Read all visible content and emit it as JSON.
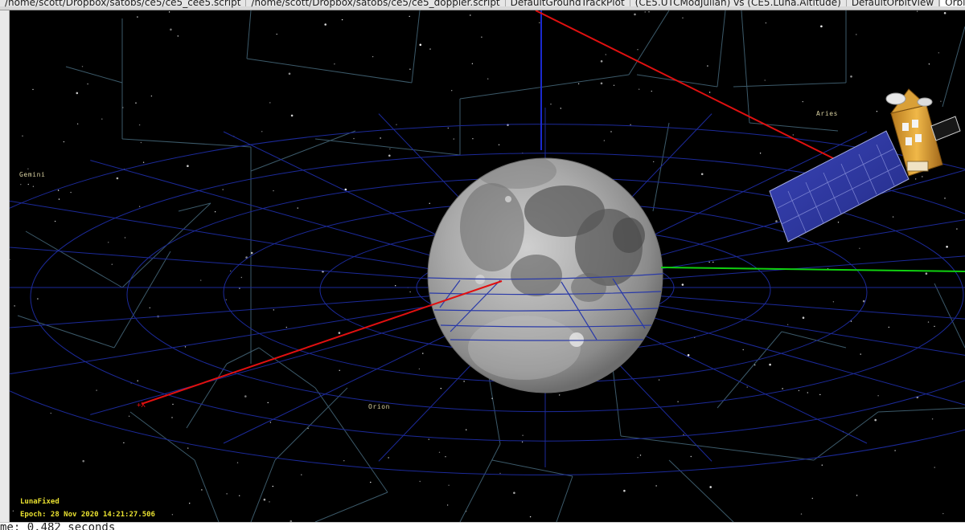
{
  "tabs": [
    {
      "label": "/home/scott/Dropbox/satobs/ce5/ce5_cee5.script",
      "active": false
    },
    {
      "label": "/home/scott/Dropbox/satobs/ce5/ce5_doppler.script",
      "active": false
    },
    {
      "label": "DefaultGroundTrackPlot",
      "active": false
    },
    {
      "label": "(CE5.UTCModJulian) vs (CE5.Luna.Altitude)",
      "active": false
    },
    {
      "label": "DefaultOrbitView",
      "active": false
    },
    {
      "label": "Orbit",
      "active": true
    }
  ],
  "view": {
    "constellations": {
      "gemini": "Gemini",
      "aries": "Aries",
      "orion": "Orion"
    },
    "coordinate_system": "LunaFixed",
    "epoch": "Epoch: 28 Nov 2020 14:21:27.506"
  },
  "console": {
    "text": "me: 0.482 seconds"
  },
  "colors": {
    "background": "#000000",
    "grid": "#1c2a9a",
    "constellation_lines": "#3c5a6a",
    "x_axis": "#e01010",
    "y_axis": "#10d010",
    "z_axis": "#1a2ad0",
    "hud_text": "#e8e030"
  },
  "icons": {
    "moon": "moon-globe",
    "spacecraft": "satellite-icon"
  }
}
